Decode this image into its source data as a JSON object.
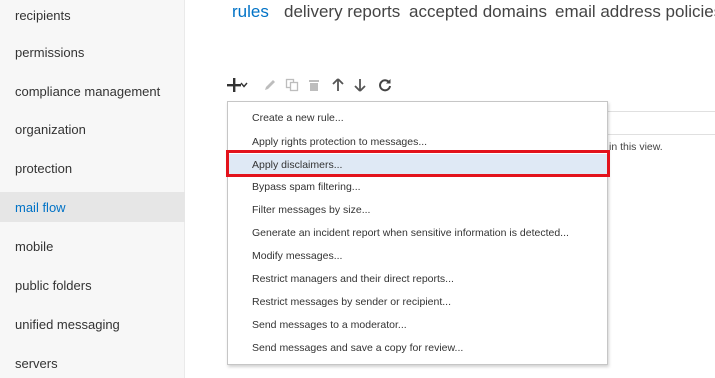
{
  "sidebar": {
    "items": [
      {
        "label": "recipients"
      },
      {
        "label": "permissions"
      },
      {
        "label": "compliance management"
      },
      {
        "label": "organization"
      },
      {
        "label": "protection"
      },
      {
        "label": "mail flow",
        "selected": true
      },
      {
        "label": "mobile"
      },
      {
        "label": "public folders"
      },
      {
        "label": "unified messaging"
      },
      {
        "label": "servers"
      }
    ]
  },
  "tabs": [
    {
      "label": "rules",
      "active": true
    },
    {
      "label": "delivery reports"
    },
    {
      "label": "accepted domains"
    },
    {
      "label": "email address policies"
    }
  ],
  "toolbar": {
    "icons": [
      "add-icon",
      "chevron-down-icon",
      "edit-icon",
      "copy-icon",
      "delete-icon",
      "move-up-icon",
      "move-down-icon",
      "refresh-icon"
    ]
  },
  "list": {
    "empty_text": "in this view."
  },
  "menu": {
    "items": [
      {
        "label": "Create a new rule..."
      },
      {
        "label": "Apply rights protection to messages..."
      },
      {
        "label": "Apply disclaimers...",
        "hovered": true
      },
      {
        "label": "Bypass spam filtering..."
      },
      {
        "label": "Filter messages by size..."
      },
      {
        "label": "Generate an incident report when sensitive information is detected..."
      },
      {
        "label": "Modify messages..."
      },
      {
        "label": "Restrict managers and their direct reports..."
      },
      {
        "label": "Restrict messages by sender or recipient..."
      },
      {
        "label": "Send messages to a moderator..."
      },
      {
        "label": "Send messages and save a copy for review..."
      }
    ]
  },
  "colors": {
    "accent": "#0072c6",
    "highlight_border": "#e3121b",
    "hover_background": "#dfe9f5"
  }
}
